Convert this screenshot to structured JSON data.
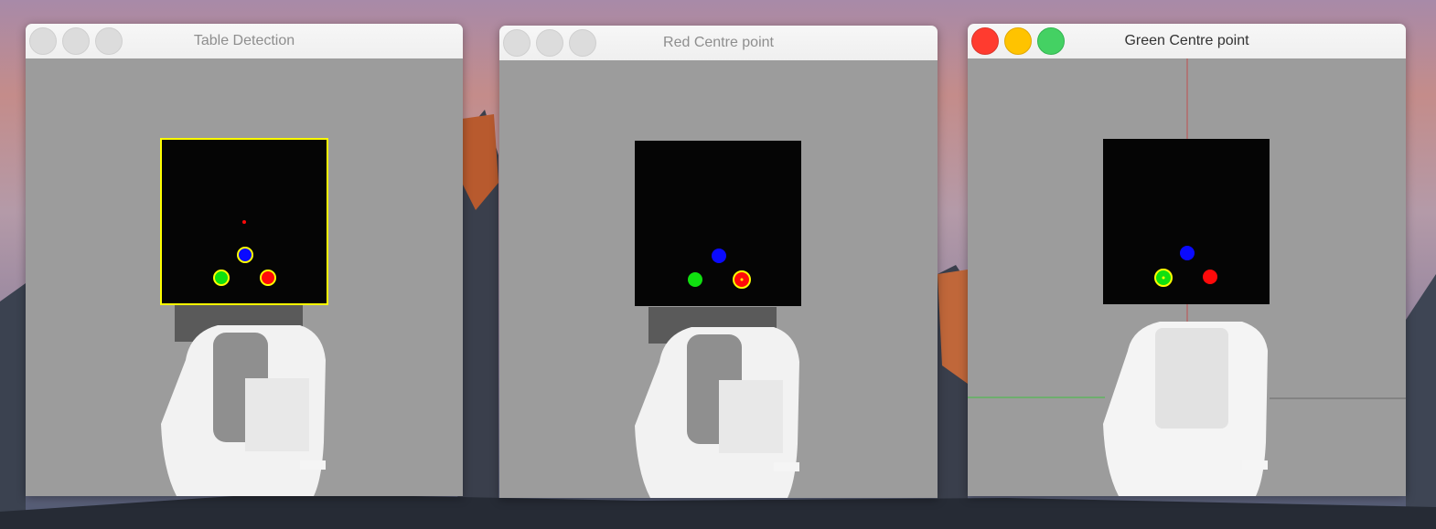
{
  "desktop": {
    "windows": [
      {
        "title": "Table Detection",
        "active": false
      },
      {
        "title": "Red Centre point",
        "active": false
      },
      {
        "title": "Green Centre point",
        "active": true
      }
    ]
  },
  "colors": {
    "table": "#050505",
    "view_background": "#9c9c9c",
    "ball_blue": "#0a0aff",
    "ball_green": "#10e010",
    "ball_red": "#ff0a0a",
    "detection_highlight": "#ffff00",
    "axis_red": "#c05050",
    "axis_green": "#40c040"
  }
}
